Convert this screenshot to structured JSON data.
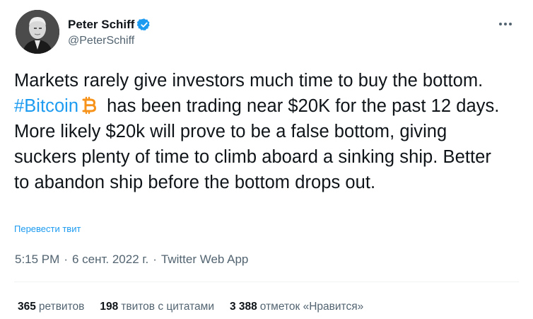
{
  "author": {
    "name": "Peter Schiff",
    "handle": "@PeterSchiff",
    "verified": true
  },
  "more_icon": "more-horizontal-icon",
  "tweet": {
    "text_part1": "Markets rarely give investors much time to buy the bottom. ",
    "hashtag": "#Bitcoin",
    "emoji": "bitcoin-icon",
    "text_part2": "has been trading near $20K for the past 12 days. More likely $20k will prove to be a false bottom, giving suckers plenty of time to climb aboard a sinking ship. Better to abandon ship before the bottom drops out."
  },
  "translate_label": "Перевести твит",
  "meta": {
    "time": "5:15 PM",
    "date": "6 сент. 2022 г.",
    "source": "Twitter Web App",
    "separator": "·"
  },
  "stats": {
    "retweets": {
      "count": "365",
      "label": "ретвитов"
    },
    "quotes": {
      "count": "198",
      "label": "твитов с цитатами"
    },
    "likes": {
      "count": "3 388",
      "label": "отметок «Нравится»"
    }
  },
  "colors": {
    "link": "#1d9bf0",
    "secondary_text": "#536471",
    "primary_text": "#0f1419",
    "bitcoin_orange": "#f7931a"
  }
}
